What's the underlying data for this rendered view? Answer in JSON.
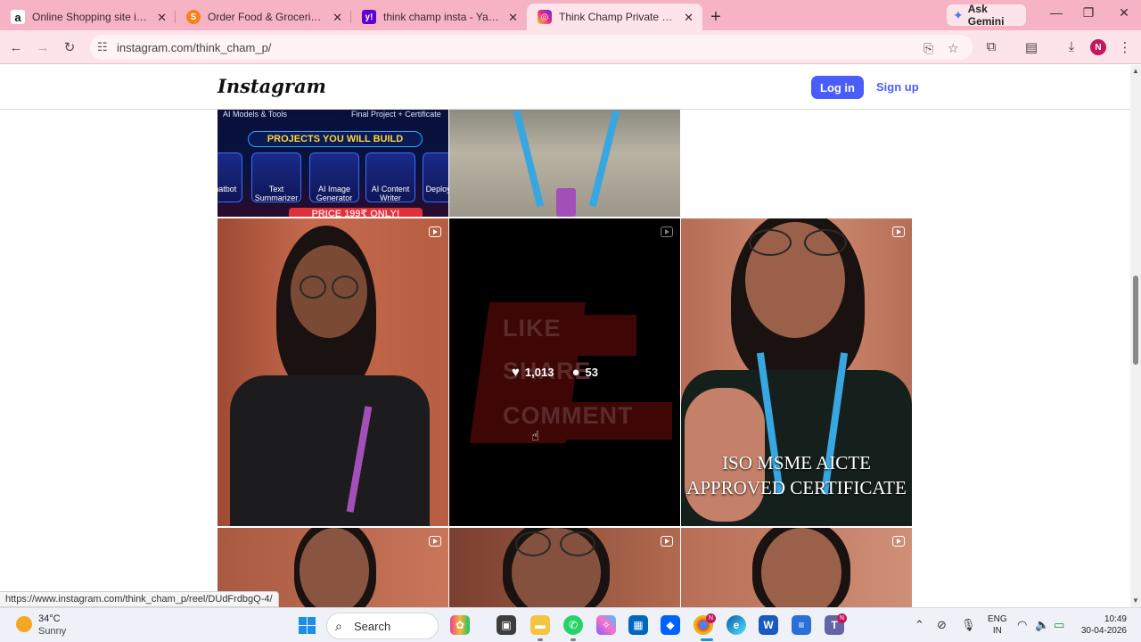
{
  "browser": {
    "tabs": [
      {
        "title": "Online Shopping site in India: S",
        "favicon": "amazon-icon",
        "favicon_glyph": "a"
      },
      {
        "title": "Order Food & Groceries. Discov",
        "favicon": "swiggy-icon",
        "favicon_glyph": "S"
      },
      {
        "title": "think champ insta - Yahoo India",
        "favicon": "yahoo-icon",
        "favicon_glyph": "y!"
      },
      {
        "title": "Think Champ Private Limited (@",
        "favicon": "instagram-icon",
        "favicon_glyph": "◎"
      }
    ],
    "ask_gemini": "Ask Gemini",
    "url": "instagram.com/think_cham_p/",
    "profile_initial": "N",
    "status_url": "https://www.instagram.com/think_cham_p/reel/DUdFrdbgQ-4/"
  },
  "instagram": {
    "logo": "Instagram",
    "login_label": "Log in",
    "signup_label": "Sign up",
    "banner": {
      "top_left": "AI Models & Tools",
      "top_right": "Final Project + Certificate",
      "title": "PROJECTS YOU WILL BUILD",
      "projects": [
        "AI Chatbot",
        "Text Summarizer",
        "AI Image Generator",
        "AI Content Writer",
        "Deploy Web"
      ],
      "price": "PRICE 199₹ ONLY!"
    },
    "hover_post": {
      "likes": "1,013",
      "comments": "53",
      "words": [
        "LIKE",
        "SHARE",
        "COMMENT"
      ]
    },
    "cert_post": {
      "line1": "ISO MSME AICTE",
      "line2": "APPROVED CERTIFICATE"
    }
  },
  "taskbar": {
    "weather_temp": "34°C",
    "weather_cond": "Sunny",
    "search_label": "Search",
    "lang_line1": "ENG",
    "lang_line2": "IN",
    "time": "10:49",
    "date": "30-04-2026"
  },
  "colors": {
    "tabbar": "#f6b3c3",
    "toolbar": "#fde3ea",
    "instagram_blue": "#4a5df9",
    "comment_overlay": "#3f0606"
  }
}
